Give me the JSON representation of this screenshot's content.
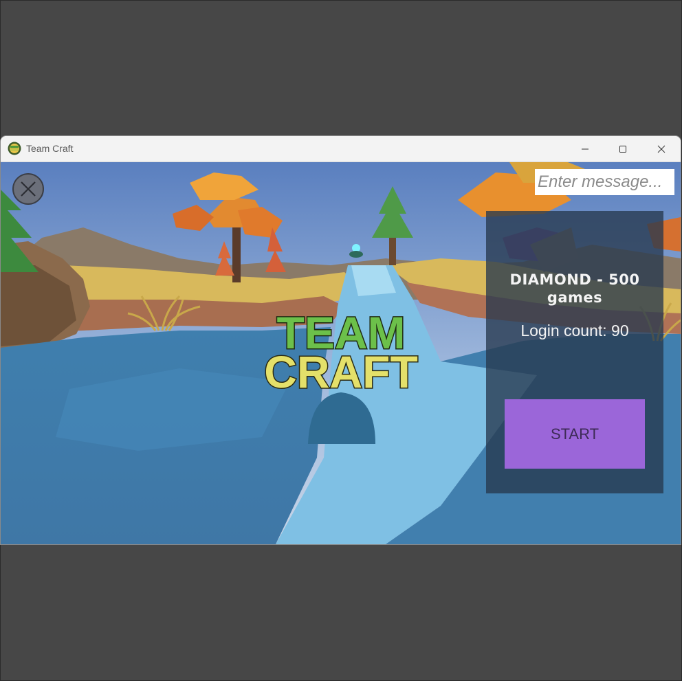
{
  "window": {
    "title": "Team Craft",
    "app_icon_text": "TEAM CRAFT",
    "controls": [
      "minimize",
      "maximize",
      "close"
    ]
  },
  "game": {
    "close_label": "X",
    "message_input": {
      "placeholder": "Enter message...",
      "value": ""
    },
    "logo": {
      "line1": "TEAM",
      "line2": "CRAFT",
      "line1_color": "#6cc04a",
      "line2_color": "#e4e06a"
    },
    "panel": {
      "rank_text": "DIAMOND - 500 games",
      "login_text": "Login count: 90",
      "start_label": "START",
      "start_color": "#9b66d9"
    }
  }
}
